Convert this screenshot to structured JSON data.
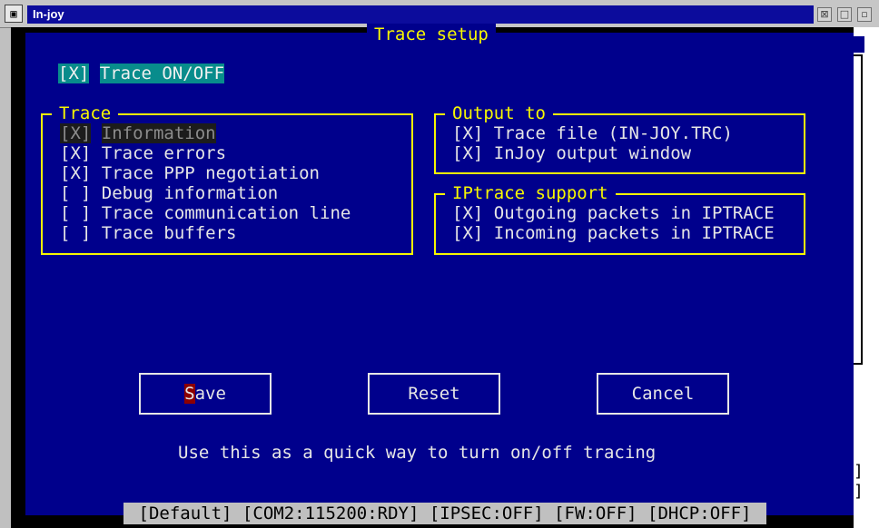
{
  "window": {
    "title": "In-joy",
    "buttons": [
      "⊠",
      "□",
      "▫"
    ]
  },
  "dialog": {
    "title": "Trace setup",
    "master_toggle": {
      "mark": "[X]",
      "label": "Trace ON/OFF"
    },
    "trace_group": {
      "title": "Trace",
      "items": [
        {
          "mark": "[X]",
          "label": "Information"
        },
        {
          "mark": "[X]",
          "label": "Trace errors"
        },
        {
          "mark": "[X]",
          "label": "Trace PPP negotiation"
        },
        {
          "mark": "[ ]",
          "label": "Debug information"
        },
        {
          "mark": "[ ]",
          "label": "Trace communication line"
        },
        {
          "mark": "[ ]",
          "label": "Trace buffers"
        }
      ]
    },
    "output_group": {
      "title": "Output to",
      "items": [
        {
          "mark": "[X]",
          "label": "Trace file (IN-JOY.TRC)"
        },
        {
          "mark": "[X]",
          "label": "InJoy output window"
        }
      ]
    },
    "iptrace_group": {
      "title": "IPtrace support",
      "items": [
        {
          "mark": "[X]",
          "label": "Outgoing packets in IPTRACE"
        },
        {
          "mark": "[X]",
          "label": "Incoming packets in IPTRACE"
        }
      ]
    },
    "buttons": {
      "save_hotkey": "S",
      "save_rest": "ave",
      "reset": "Reset",
      "cancel": "Cancel"
    },
    "hint": "Use this as a quick way to turn on/off tracing"
  },
  "statusbar": {
    "text": "[Default] [COM2:115200:RDY] [IPSEC:OFF] [FW:OFF] [DHCP:OFF]"
  },
  "colors": {
    "background": "#00008c",
    "frame": "#f8f800",
    "highlight": "#088c8c"
  }
}
